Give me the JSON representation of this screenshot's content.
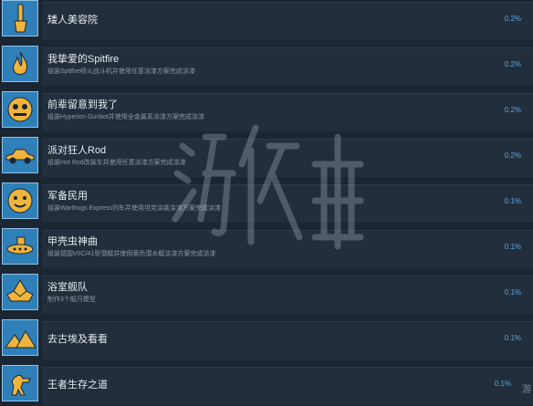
{
  "achievements": [
    {
      "title": "矮人美容院",
      "desc": "",
      "percent": "0.2%",
      "icon": "paint-brush-icon"
    },
    {
      "title": "我挚爱的Spitfire",
      "desc": "组装Spitfire喷火战斗机并使用任意涂漆方案完成涂漆",
      "percent": "0.2%",
      "icon": "flame-icon"
    },
    {
      "title": "前辈留意到我了",
      "desc": "组装Hyperion Gunbot并使用全金属系涂漆方案完成涂漆",
      "percent": "0.2%",
      "icon": "robot-face-icon"
    },
    {
      "title": "派对狂人Rod",
      "desc": "组装Hot Rod改装车并使用任意涂漆方案完成涂漆",
      "percent": "0.2%",
      "icon": "hot-rod-car-icon"
    },
    {
      "title": "军备民用",
      "desc": "组装Warthogs Express列车并使用坦克涂装涂漆方案完成涂漆",
      "percent": "0.1%",
      "icon": "train-face-icon"
    },
    {
      "title": "甲壳虫神曲",
      "desc": "组装德国VIIC/41型潜艇并使用黄色潜水艇涂漆方案完成涂漆",
      "percent": "0.1%",
      "icon": "submarine-icon"
    },
    {
      "title": "浴室舰队",
      "desc": "制作3个船只模型",
      "percent": "0.1%",
      "icon": "paper-boat-icon"
    },
    {
      "title": "去古埃及看看",
      "desc": "",
      "percent": "0.1%",
      "icon": "pyramids-icon"
    },
    {
      "title": "王者生存之道",
      "desc": "",
      "percent": "0.1%",
      "icon": "dinosaur-icon"
    }
  ],
  "watermark_tail": "游"
}
